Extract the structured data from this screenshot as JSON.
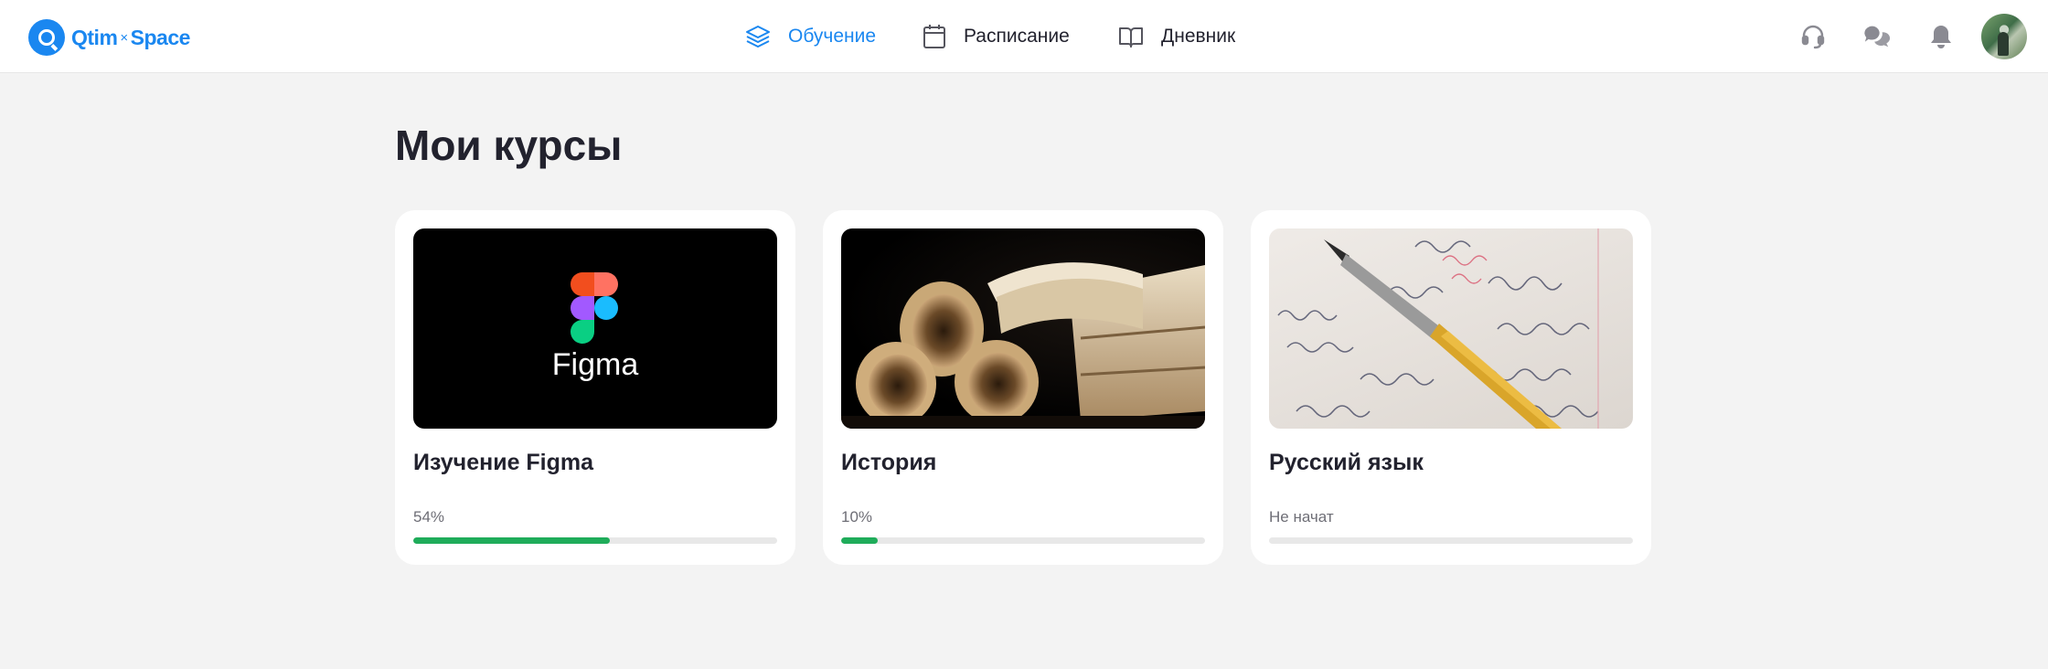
{
  "brand": {
    "name_left": "Qtim",
    "separator": "×",
    "name_right": "Space"
  },
  "nav": [
    {
      "label": "Обучение",
      "icon": "layers-icon",
      "active": true
    },
    {
      "label": "Расписание",
      "icon": "calendar-icon",
      "active": false
    },
    {
      "label": "Дневник",
      "icon": "book-open-icon",
      "active": false
    }
  ],
  "header_icons": [
    "headset-icon",
    "chat-bubbles-icon",
    "bell-icon",
    "avatar"
  ],
  "page": {
    "title": "Мои курсы"
  },
  "courses": [
    {
      "title": "Изучение Figma",
      "thumb_text": "Figma",
      "thumb_icon": "figma-logo-icon",
      "progress_label": "54%",
      "progress": 0.54
    },
    {
      "title": "История",
      "thumb_icon": "old-books-scrolls-image",
      "progress_label": "10%",
      "progress": 0.1
    },
    {
      "title": "Русский язык",
      "thumb_icon": "fountain-pen-handwriting-image",
      "progress_label": "Не начат",
      "progress": 0
    }
  ],
  "colors": {
    "accent": "#1a87f0",
    "progress": "#1fac5a",
    "background": "#f3f3f3",
    "text": "#22222e"
  }
}
